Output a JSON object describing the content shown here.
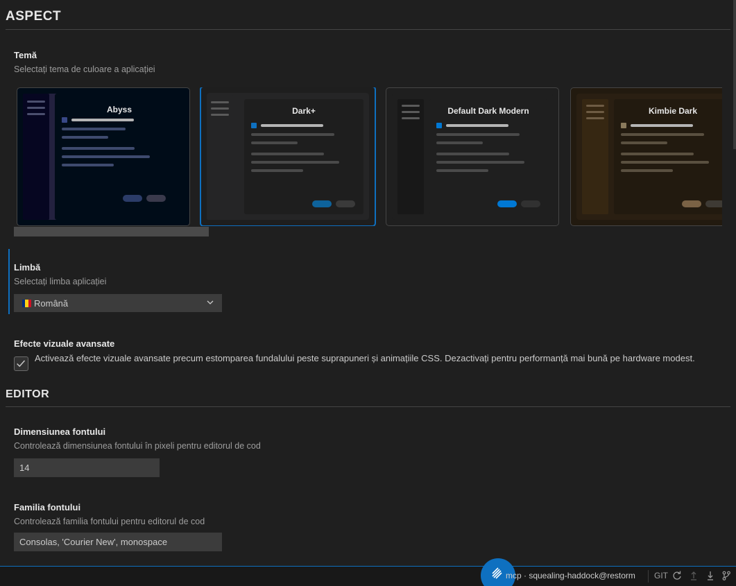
{
  "sections": {
    "appearance": "ASPECT",
    "editor": "EDITOR"
  },
  "theme": {
    "label": "Temă",
    "description": "Selectați tema de culoare a aplicației",
    "cards": [
      {
        "name": "Abyss",
        "selected": false,
        "colors": {
          "bg": "#000c18",
          "frame": "#23213f",
          "side": "#060621",
          "editor": "#000c18",
          "bullet": "#384887",
          "line": "#3e4a6e",
          "btn1": "#2b3c68",
          "btn2": "#3a3a4c",
          "sideline": "#4b4f6e"
        }
      },
      {
        "name": "Dark+",
        "selected": true,
        "colors": {
          "bg": "#1e1e1e",
          "frame": "#252526",
          "side": "#252526",
          "editor": "#1e1e1e",
          "bullet": "#0e70c0",
          "line": "#4a4a4a",
          "btn1": "#0e639c",
          "btn2": "#3a3a3a",
          "sideline": "#5a5a5a"
        }
      },
      {
        "name": "Default Dark Modern",
        "selected": false,
        "colors": {
          "bg": "#1f1f1f",
          "frame": "#1f1f1f",
          "side": "#181818",
          "editor": "#1f1f1f",
          "bullet": "#0078d4",
          "line": "#4a4a4a",
          "btn1": "#0078d4",
          "btn2": "#313131",
          "sideline": "#5a5a5a"
        }
      },
      {
        "name": "Kimbie Dark",
        "selected": false,
        "colors": {
          "bg": "#221a0f",
          "frame": "#2a1f12",
          "side": "#362712",
          "editor": "#221a0f",
          "bullet": "#8a7a5c",
          "line": "#5a5040",
          "btn1": "#7a6245",
          "btn2": "#3e3a34",
          "sideline": "#6e5c44"
        }
      }
    ]
  },
  "language": {
    "label": "Limbă",
    "description": "Selectați limba aplicației",
    "value": "Română",
    "flag_colors": [
      "#002b7f",
      "#fcd116",
      "#ce1126"
    ]
  },
  "effects": {
    "label": "Efecte vizuale avansate",
    "checked": true,
    "text": "Activează efecte vizuale avansate precum estomparea fundalului peste suprapuneri și animațiile CSS. Dezactivați pentru performanță mai bună pe hardware modest."
  },
  "font_size": {
    "label": "Dimensiunea fontului",
    "description": "Controlează dimensiunea fontului în pixeli pentru editorul de cod",
    "value": "14"
  },
  "font_family": {
    "label": "Familia fontului",
    "description": "Controlează familia fontului pentru editorul de cod",
    "value": "Consolas, 'Courier New', monospace"
  },
  "statusbar": {
    "connection": "mcp · squealing-haddock@restorm",
    "git": "GIT"
  }
}
